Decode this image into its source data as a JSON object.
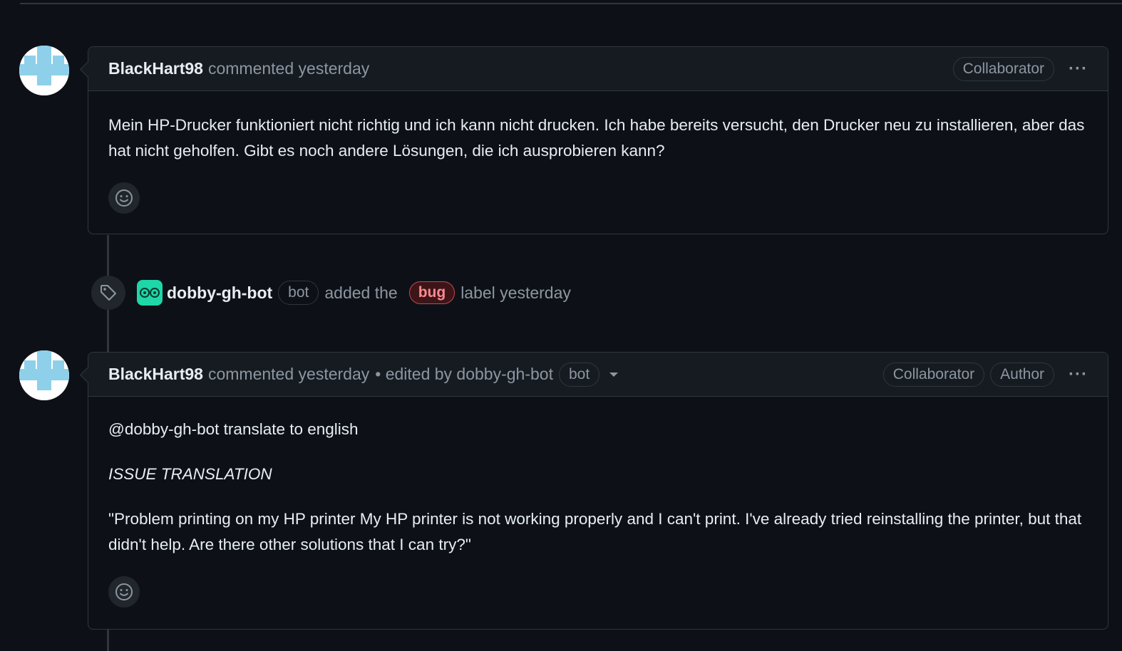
{
  "comment1": {
    "author": "BlackHart98",
    "meta": "commented yesterday",
    "badge": "Collaborator",
    "menu": "···",
    "body": [
      "Mein HP-Drucker funktioniert nicht richtig und ich kann nicht drucken. Ich habe bereits versucht, den Drucker neu zu installieren, aber das hat nicht geholfen. Gibt es noch andere Lösungen, die ich ausprobieren kann?"
    ]
  },
  "event": {
    "actor": "dobby-gh-bot",
    "actor_badge": "bot",
    "action": "added the",
    "label": "bug",
    "suffix": "label yesterday",
    "icon": "tag-icon"
  },
  "comment2": {
    "author": "BlackHart98",
    "meta": "commented yesterday",
    "edited": "• edited by dobby-gh-bot",
    "edited_badge": "bot",
    "badges": [
      "Collaborator",
      "Author"
    ],
    "menu": "···",
    "mention_line": "@dobby-gh-bot translate to english",
    "heading": "ISSUE TRANSLATION",
    "translation": "\"Problem printing on my HP printer My HP printer is not working properly and I can't print. I've already tried reinstalling the printer, but that didn't help. Are there other solutions that I can try?\""
  },
  "colors": {
    "background": "#0d1117",
    "header": "#161b22",
    "border": "#30363d",
    "muted": "#8d96a0",
    "bug_label": "#c4474f",
    "bot_avatar": "#1fd6a8"
  },
  "icons": [
    "identicon-avatar",
    "smiley-icon",
    "tag-icon",
    "bot-avatar",
    "kebab-icon",
    "caret-down-icon"
  ]
}
